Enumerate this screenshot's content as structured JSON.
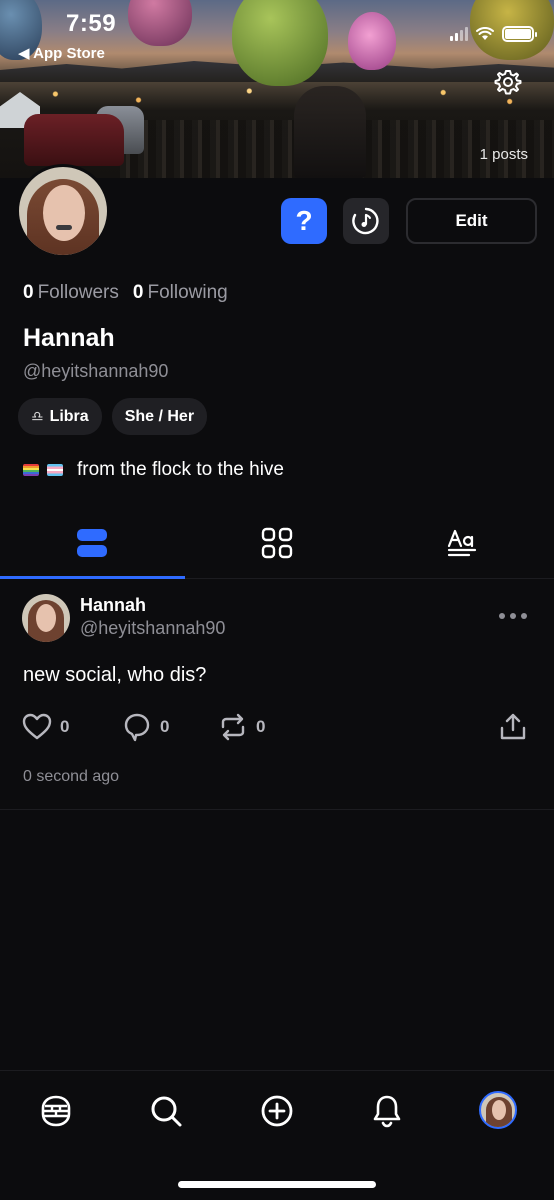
{
  "status_bar": {
    "time": "7:59",
    "back_label": "◀ App Store"
  },
  "header": {
    "posts_count": "1 posts"
  },
  "profile": {
    "help_label": "?",
    "edit_label": "Edit",
    "followers_count": "0",
    "followers_label": "Followers",
    "following_count": "0",
    "following_label": "Following",
    "name": "Hannah",
    "handle": "@heyitshannah90",
    "chips": [
      {
        "label": "Libra",
        "icon": "libra-icon"
      },
      {
        "label": "She / Her"
      }
    ],
    "bio": "from the flock to the hive"
  },
  "tabs": [
    {
      "icon": "feed-icon",
      "active": true
    },
    {
      "icon": "grid-icon"
    },
    {
      "icon": "text-icon"
    }
  ],
  "post": {
    "author": "Hannah",
    "handle": "@heyitshannah90",
    "text": "new social, who dis?",
    "likes": "0",
    "comments": "0",
    "reposts": "0",
    "time": "0 second ago"
  },
  "nav": [
    "hive-icon",
    "search-icon",
    "add-icon",
    "bell-icon",
    "profile-avatar"
  ],
  "colors": {
    "accent": "#2f6bff",
    "background": "#0c0c0e",
    "muted": "#8f8f96"
  }
}
